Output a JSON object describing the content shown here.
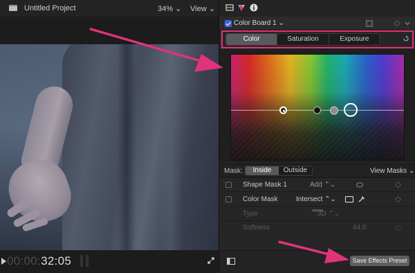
{
  "viewer": {
    "project_title": "Untitled Project",
    "zoom": "34% ⌄",
    "view_menu": "View ⌄",
    "timecode_dim": "00:00:",
    "timecode_lit": "32:05"
  },
  "inspector": {
    "effect_name": "Color Board 1 ⌄",
    "tabs": [
      "Color",
      "Saturation",
      "Exposure"
    ],
    "mask": {
      "label": "Mask:",
      "options": [
        "Inside",
        "Outside"
      ],
      "view_masks": "View Masks ⌄"
    },
    "rows": [
      {
        "name": "Shape Mask 1",
        "value": "Add ⌃⌄"
      },
      {
        "name": "Color Mask",
        "value": "Intersect ⌃⌄"
      },
      {
        "name": "Type",
        "value": "3D ⌃⌄"
      },
      {
        "name": "Softness",
        "value": "44.0"
      }
    ],
    "save_preset": "Save Effects Preset"
  },
  "colors": {
    "highlight": "#e0337a",
    "checkbox_blue": "#3c67d8"
  }
}
